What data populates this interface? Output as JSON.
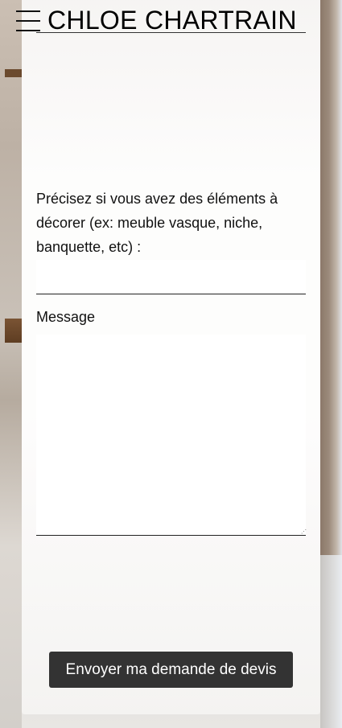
{
  "header": {
    "menu_icon": "hamburger-menu-icon",
    "site_title": "CHLOE CHARTRAIN"
  },
  "form": {
    "elements_label": "Précisez si vous avez des éléments à décorer (ex: meuble vasque, niche, banquette, etc) :",
    "elements_value": "",
    "message_label": "Message",
    "message_value": "",
    "submit_label": "Envoyer ma demande de devis"
  },
  "colors": {
    "button_bg": "#333333",
    "button_text": "#ffffff",
    "text": "#111111"
  }
}
